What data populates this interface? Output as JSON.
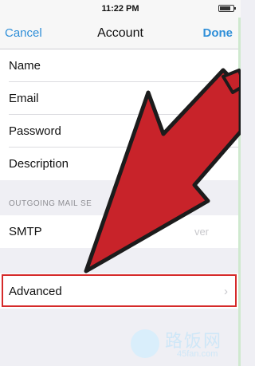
{
  "status_bar": {
    "time": "11:22 PM"
  },
  "nav": {
    "cancel": "Cancel",
    "title": "Account",
    "done": "Done"
  },
  "account_rows": [
    {
      "label": "Name"
    },
    {
      "label": "Email"
    },
    {
      "label": "Password"
    },
    {
      "label": "Description"
    }
  ],
  "outgoing": {
    "header": "OUTGOING MAIL SE",
    "smtp_label": "SMTP",
    "smtp_value": "ver"
  },
  "advanced": {
    "label": "Advanced"
  },
  "watermark": {
    "text": "路饭网",
    "sub": "45fan.com"
  },
  "colors": {
    "accent": "#2f8fd8",
    "highlight": "#d52a2a",
    "arrow": "#c8232a"
  }
}
